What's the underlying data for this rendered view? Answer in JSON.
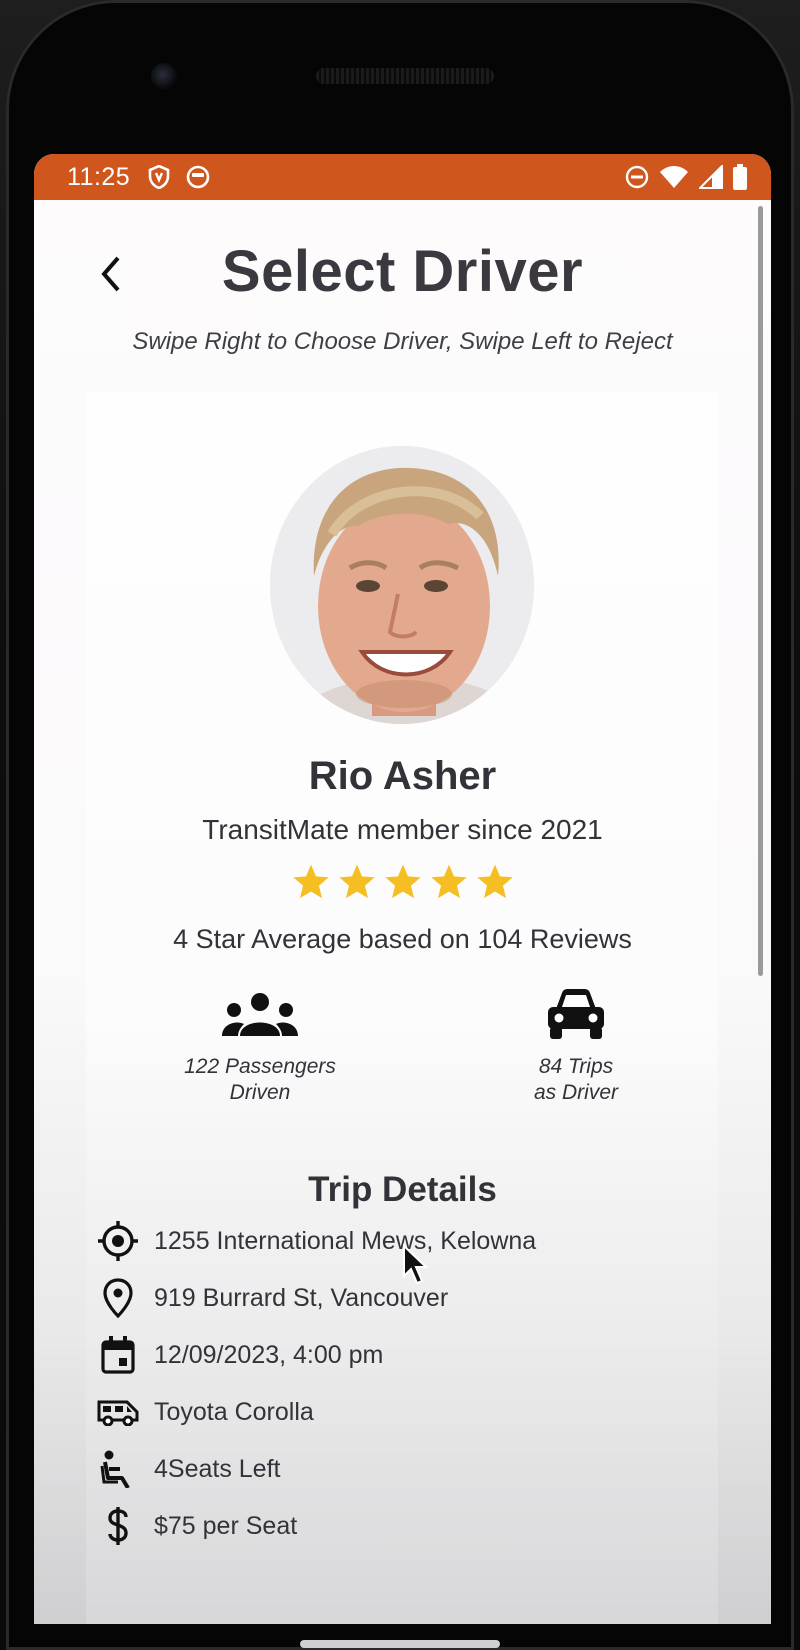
{
  "status_bar": {
    "time": "11:25",
    "left_icons": [
      "shield-icon",
      "app-notification-icon"
    ],
    "right_icons": [
      "do-not-disturb-icon",
      "wifi-icon",
      "cell-signal-icon",
      "battery-icon"
    ],
    "background_color": "#cf561d"
  },
  "header": {
    "title": "Select Driver",
    "back_icon": "chevron-left-icon"
  },
  "subtitle": "Swipe Right to Choose Driver, Swipe Left to Reject",
  "driver": {
    "name": "Rio Asher",
    "member_since": "TransitMate member since 2021",
    "stars": 5,
    "star_color": "#f5bf24",
    "rating_summary": "4 Star Average based on 104 Reviews",
    "stats": [
      {
        "icon": "passengers-icon",
        "line1": "122 Passengers",
        "line2": "Driven"
      },
      {
        "icon": "car-icon",
        "line1": "84 Trips",
        "line2": "as Driver"
      }
    ]
  },
  "trip_details": {
    "title": "Trip Details",
    "rows": [
      {
        "icon": "gps-target-icon",
        "text": "1255 International Mews, Kelowna"
      },
      {
        "icon": "location-pin-icon",
        "text": "919 Burrard St, Vancouver"
      },
      {
        "icon": "calendar-icon",
        "text": "12/09/2023, 4:00 pm"
      },
      {
        "icon": "vehicle-icon",
        "text": "Toyota Corolla"
      },
      {
        "icon": "seat-icon",
        "text": "4Seats Left"
      },
      {
        "icon": "dollar-icon",
        "text": "$75 per Seat"
      }
    ]
  }
}
